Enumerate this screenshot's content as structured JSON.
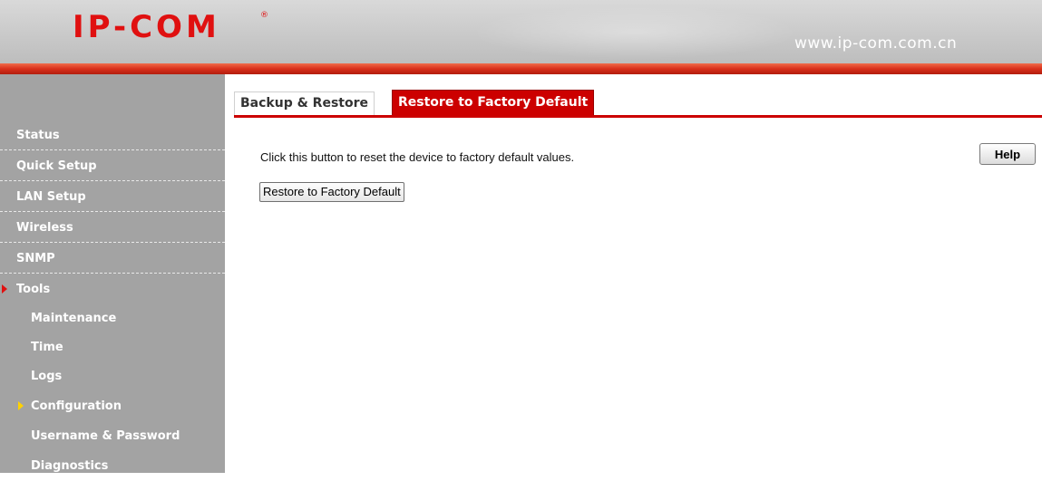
{
  "header": {
    "logo": "IP-COM",
    "logo_mark": "®",
    "url": "www.ip-com.com.cn"
  },
  "sidebar": {
    "items": [
      {
        "label": "Status"
      },
      {
        "label": "Quick Setup"
      },
      {
        "label": "LAN Setup"
      },
      {
        "label": "Wireless"
      },
      {
        "label": "SNMP"
      },
      {
        "label": "Tools"
      }
    ],
    "sub_items": [
      {
        "label": "Maintenance"
      },
      {
        "label": "Time"
      },
      {
        "label": "Logs"
      },
      {
        "label": "Configuration"
      },
      {
        "label": "Username & Password"
      },
      {
        "label": "Diagnostics"
      }
    ],
    "active_section": "Tools",
    "active_item": "Configuration"
  },
  "tabs": [
    {
      "label": "Backup & Restore",
      "active": false
    },
    {
      "label": "Restore to Factory Default",
      "active": true
    }
  ],
  "main": {
    "description": "Click this button to reset the device to factory default values.",
    "restore_button": "Restore to Factory Default",
    "help_button": "Help"
  },
  "colors": {
    "brand_red": "#cc0000",
    "sidebar_bg": "#a3a3a3",
    "active_arrow_tools": "#e01010",
    "active_arrow_sub": "#ffd200"
  },
  "icons": [
    "tools-active-arrow-icon",
    "configuration-active-arrow-icon"
  ]
}
